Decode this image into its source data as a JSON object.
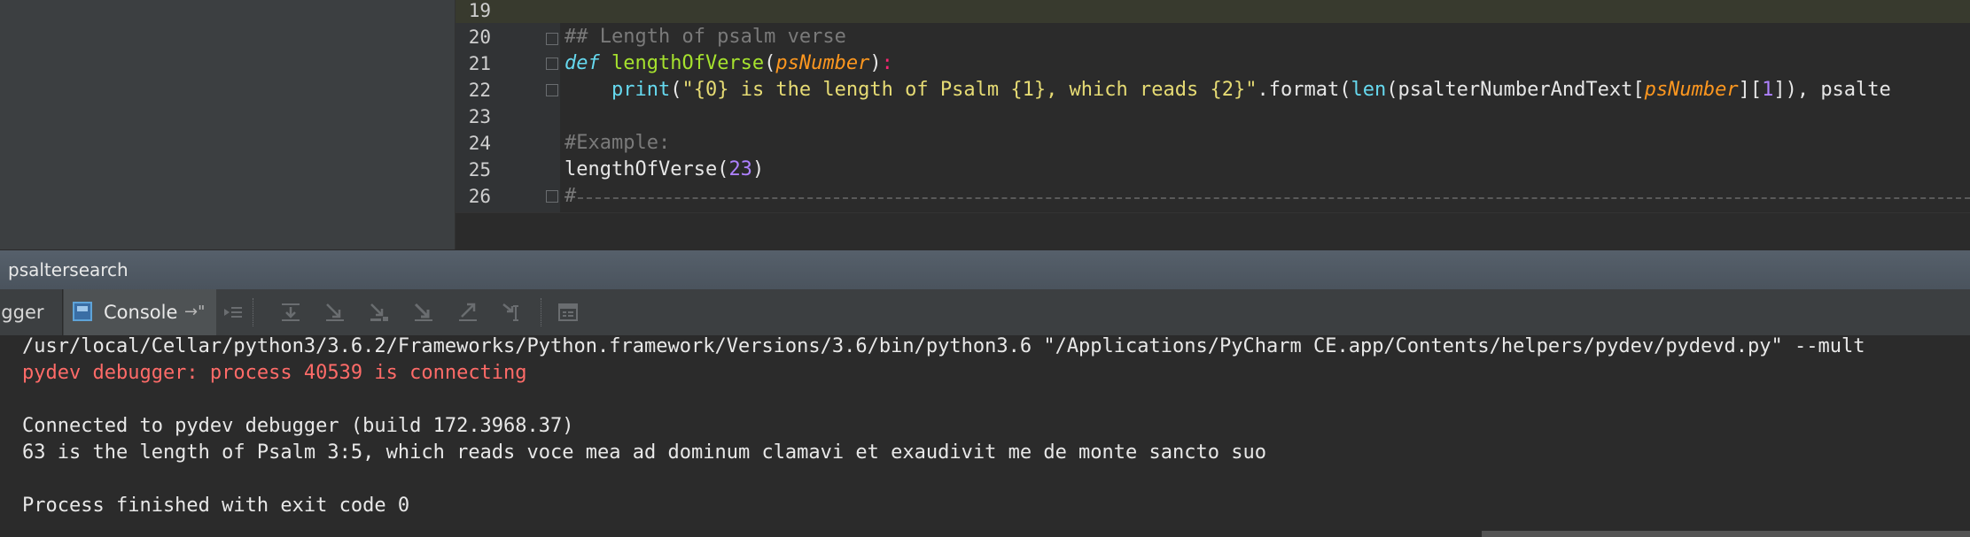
{
  "editor": {
    "line_numbers": [
      "19",
      "20",
      "21",
      "22",
      "23",
      "24",
      "25",
      "26"
    ],
    "lines": [
      [],
      [
        {
          "t": "## Length of psalm verse",
          "c": "c-comment"
        }
      ],
      [
        {
          "t": "def ",
          "c": "c-kw"
        },
        {
          "t": "lengthOfVerse",
          "c": "c-fn"
        },
        {
          "t": "(",
          "c": "c-plain"
        },
        {
          "t": "psNumber",
          "c": "c-param"
        },
        {
          "t": ")",
          "c": "c-plain"
        },
        {
          "t": ":",
          "c": "c-punc"
        }
      ],
      [
        {
          "t": "    print",
          "c": "c-builtin"
        },
        {
          "t": "(",
          "c": "c-plain"
        },
        {
          "t": "\"{0} is the length of Psalm {1}, which reads {2}\"",
          "c": "c-str"
        },
        {
          "t": ".format(",
          "c": "c-plain"
        },
        {
          "t": "len",
          "c": "c-builtin"
        },
        {
          "t": "(psalterNumberAndText[",
          "c": "c-plain"
        },
        {
          "t": "psNumber",
          "c": "c-param"
        },
        {
          "t": "][",
          "c": "c-plain"
        },
        {
          "t": "1",
          "c": "c-num"
        },
        {
          "t": "]), ",
          "c": "c-plain"
        },
        {
          "t": "psalte",
          "c": "c-plain"
        }
      ],
      [],
      [
        {
          "t": "#Example:",
          "c": "c-comment"
        }
      ],
      [
        {
          "t": "lengthOfVerse(",
          "c": "c-plain"
        },
        {
          "t": "23",
          "c": "c-num"
        },
        {
          "t": ")",
          "c": "c-plain"
        }
      ],
      [
        {
          "t": "#",
          "c": "c-comment"
        }
      ]
    ]
  },
  "run_window": {
    "title": "psaltersearch",
    "tabs": {
      "debugger": "ugger",
      "console": "Console",
      "console_pin": "→\""
    }
  },
  "toolbar_icons": [
    "show-execution-point-icon",
    "step-over-icon",
    "step-into-icon",
    "step-into-my-code-icon",
    "force-step-into-icon",
    "step-out-icon",
    "run-to-cursor-icon",
    "evaluate-expression-icon"
  ],
  "console": {
    "lines": [
      {
        "text": "/usr/local/Cellar/python3/3.6.2/Frameworks/Python.framework/Versions/3.6/bin/python3.6 \"/Applications/PyCharm CE.app/Contents/helpers/pydev/pydevd.py\" --mult",
        "kind": "out-normal"
      },
      {
        "text": "pydev debugger: process 40539 is connecting",
        "kind": "out-error"
      },
      {
        "text": "",
        "kind": "out-normal"
      },
      {
        "text": "Connected to pydev debugger (build 172.3968.37)",
        "kind": "out-normal"
      },
      {
        "text": "63 is the length of Psalm 3:5, which reads voce mea ad dominum clamavi et exaudivit me de monte sancto suo",
        "kind": "out-normal"
      },
      {
        "text": "",
        "kind": "out-normal"
      },
      {
        "text": "Process finished with exit code 0",
        "kind": "out-normal"
      }
    ]
  }
}
